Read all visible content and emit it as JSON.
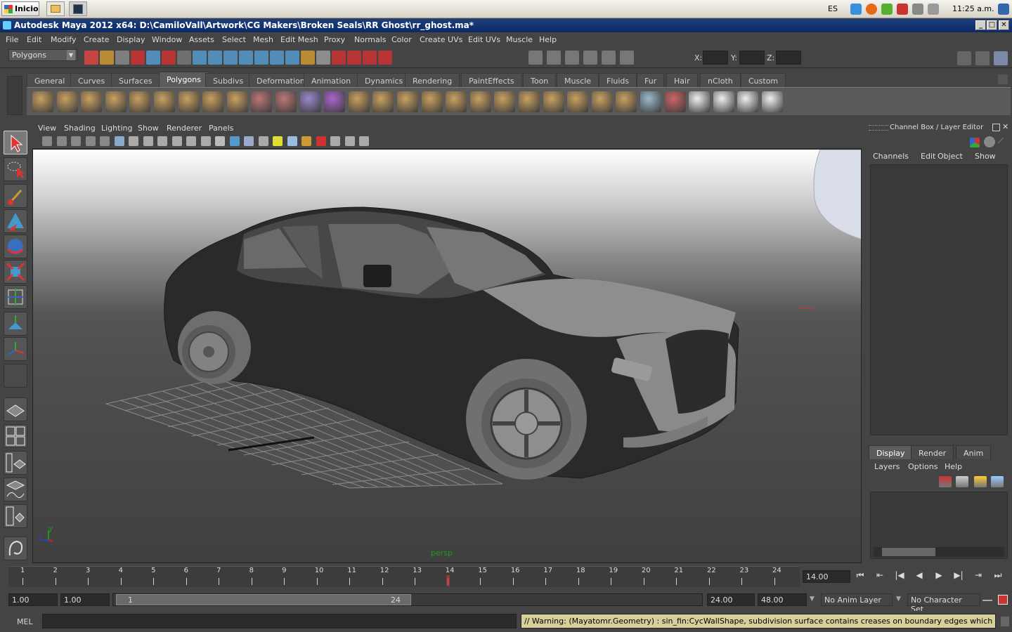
{
  "taskbar": {
    "start_label": "Inicio",
    "language": "ES",
    "clock": "11:25 a.m."
  },
  "window": {
    "title": "Autodesk Maya 2012 x64: D:\\CamiloVall\\Artwork\\CG Makers\\Broken Seals\\RR Ghost\\rr_ghost.ma*",
    "min": "_",
    "max": "□",
    "close": "✕"
  },
  "menubar": [
    "File",
    "Edit",
    "Modify",
    "Create",
    "Display",
    "Window",
    "Assets",
    "Select",
    "Mesh",
    "Edit Mesh",
    "Proxy",
    "Normals",
    "Color",
    "Create UVs",
    "Edit UVs",
    "Muscle",
    "Help"
  ],
  "status_line": {
    "mode": "Polygons",
    "x_label": "X:",
    "y_label": "Y:",
    "z_label": "Z:"
  },
  "shelf_tabs": [
    "General",
    "Curves",
    "Surfaces",
    "Polygons",
    "Subdivs",
    "Deformation",
    "Animation",
    "Dynamics",
    "Rendering",
    "PaintEffects",
    "Toon",
    "Muscle",
    "Fluids",
    "Fur",
    "Hair",
    "nCloth",
    "Custom"
  ],
  "shelf_active": "Polygons",
  "panel_menu": [
    "View",
    "Shading",
    "Lighting",
    "Show",
    "Renderer",
    "Panels"
  ],
  "viewport": {
    "camera": "persp",
    "axis_y": "y",
    "axis_z": "z",
    "axis_x": "x"
  },
  "channel_box": {
    "title": "Channel Box / Layer Editor",
    "menu": [
      "Channels",
      "Edit",
      "Object",
      "Show"
    ]
  },
  "layer_editor": {
    "tabs": [
      "Display",
      "Render",
      "Anim"
    ],
    "active_tab": "Display",
    "menu": [
      "Layers",
      "Options",
      "Help"
    ]
  },
  "time_slider": {
    "ticks": [
      "1",
      "2",
      "3",
      "4",
      "5",
      "6",
      "7",
      "8",
      "9",
      "10",
      "11",
      "12",
      "13",
      "14",
      "15",
      "16",
      "17",
      "18",
      "19",
      "20",
      "21",
      "22",
      "23",
      "24"
    ],
    "current_frame": "14.00"
  },
  "playback": [
    "⏮",
    "⇤",
    "|◀",
    "◀",
    "▶",
    "▶|",
    "⇥",
    "⏭"
  ],
  "range_slider": {
    "start_time": "1.00",
    "range_start": "1.00",
    "handle_start": "1",
    "handle_end": "24",
    "range_end": "24.00",
    "end_time": "48.00",
    "anim_layer": "No Anim Layer",
    "character_set": "No Character Set"
  },
  "command_line": {
    "label": "MEL",
    "input": "",
    "feedback": "// Warning: (Mayatomr.Geometry) : sin_fin:CycWallShape, subdivision surface contains creases on boundary edges which are unsupported :"
  }
}
